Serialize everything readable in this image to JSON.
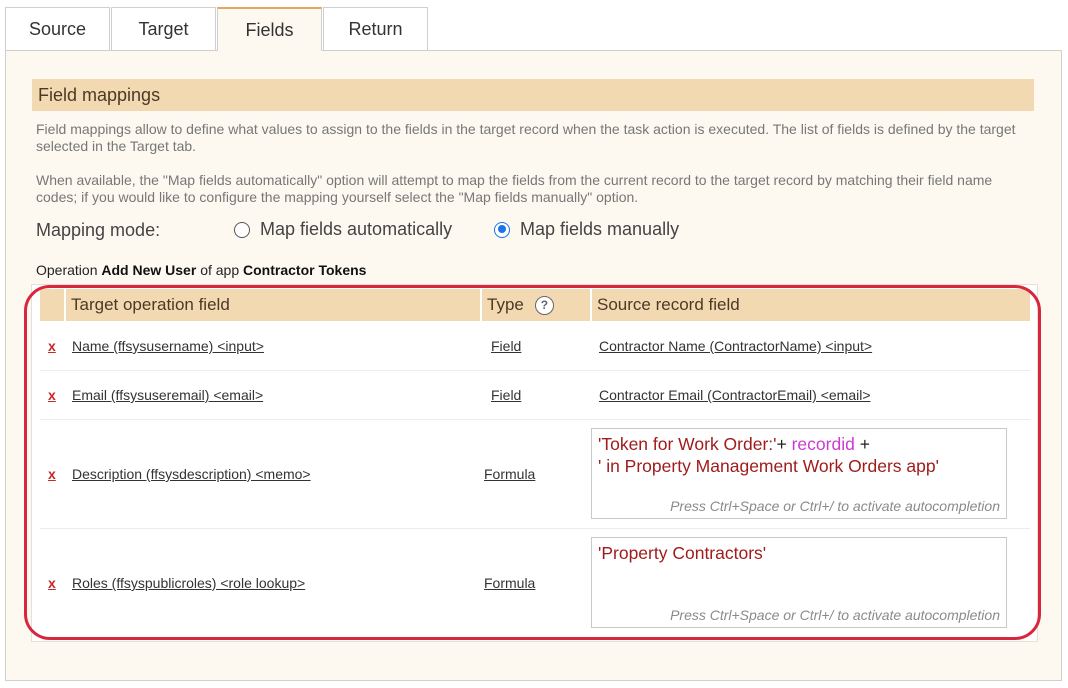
{
  "tabs": [
    {
      "label": "Source",
      "active": false
    },
    {
      "label": "Target",
      "active": false
    },
    {
      "label": "Fields",
      "active": true
    },
    {
      "label": "Return",
      "active": false
    }
  ],
  "section": {
    "title": "Field mappings",
    "desc1": "Field mappings allow to define what values to assign to the fields in the target record when the task action is executed. The list of fields is defined by the target selected in the Target tab.",
    "desc2": "When available, the \"Map fields automatically\" option will attempt to map the fields from the current record to the target record by matching their field name codes; if you would like to configure the mapping yourself select the \"Map fields manually\" option."
  },
  "mapping": {
    "label": "Mapping mode:",
    "options": [
      "Map fields automatically",
      "Map fields manually"
    ],
    "selected": "Map fields manually"
  },
  "operation": {
    "prefix": "Operation",
    "name": "Add New User",
    "middle": "of app",
    "app": "Contractor Tokens"
  },
  "table": {
    "headers": {
      "target": "Target operation field",
      "type": "Type",
      "source": "Source record field"
    },
    "rows": [
      {
        "delete": "x",
        "target": "Name (ffsysusername) <input>",
        "type": "Field",
        "source": "Contractor Name (ContractorName) <input>"
      },
      {
        "delete": "x",
        "target": "Email (ffsysuseremail) <email>",
        "type": "Field",
        "source": "Contractor Email (ContractorEmail) <email>"
      },
      {
        "delete": "x",
        "target": "Description (ffsysdescription) <memo>",
        "type": "Formula",
        "formula_lines": {
          "l1_str": "'Token for Work Order:'",
          "l1_op1": "+ ",
          "l1_kw": "recordid",
          "l1_op2": " +",
          "l2_str": "' in Property Management Work Orders app'"
        }
      },
      {
        "delete": "x",
        "target": "Roles (ffsyspublicroles) <role lookup>",
        "type": "Formula",
        "formula_lines": {
          "l1_str": "'Property Contractors'"
        }
      }
    ],
    "formula_hint": "Press Ctrl+Space or Ctrl+/ to activate autocompletion"
  },
  "colors": {
    "accent": "#f3d9b1",
    "highlight": "#d7263d",
    "radio": "#1a73e8"
  }
}
